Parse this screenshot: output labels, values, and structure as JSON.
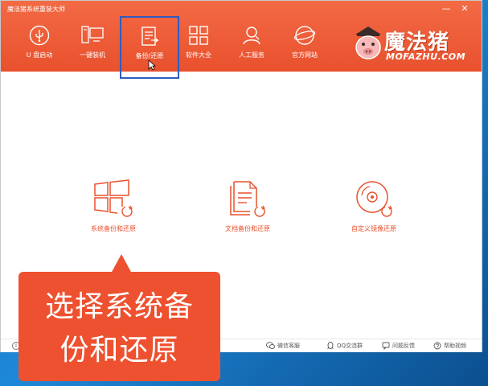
{
  "window": {
    "title": "魔法猪系统重装大师"
  },
  "controls": {
    "minimize": "—",
    "close": "✕"
  },
  "nav": [
    {
      "label": "U 盘启动",
      "icon": "usb-icon"
    },
    {
      "label": "一键装机",
      "icon": "desktop-icon"
    },
    {
      "label": "备份/还原",
      "icon": "backup-doc-icon",
      "active": true
    },
    {
      "label": "软件大全",
      "icon": "grid-apps-icon"
    },
    {
      "label": "人工服务",
      "icon": "person-icon"
    },
    {
      "label": "官方网站",
      "icon": "globe-icon"
    }
  ],
  "logo": {
    "cn": "魔法猪",
    "en": "MOFAZHU.COM"
  },
  "features": [
    {
      "label": "系统备份和还原",
      "icon": "windows-restore-icon"
    },
    {
      "label": "文档备份和还原",
      "icon": "document-restore-icon"
    },
    {
      "label": "自定义镜像还原",
      "icon": "disc-image-icon"
    }
  ],
  "statusbar": {
    "info": "i",
    "items": [
      {
        "label": "微信客服",
        "icon": "wechat-icon"
      },
      {
        "label": "QQ交流群",
        "icon": "qq-icon"
      },
      {
        "label": "问题反馈",
        "icon": "feedback-icon"
      },
      {
        "label": "帮助视频",
        "icon": "help-icon"
      }
    ]
  },
  "callout": {
    "line1": "选择系统备",
    "line2": "份和还原"
  },
  "colors": {
    "accent": "#e9512d",
    "highlight_border": "#2f5cc0"
  }
}
